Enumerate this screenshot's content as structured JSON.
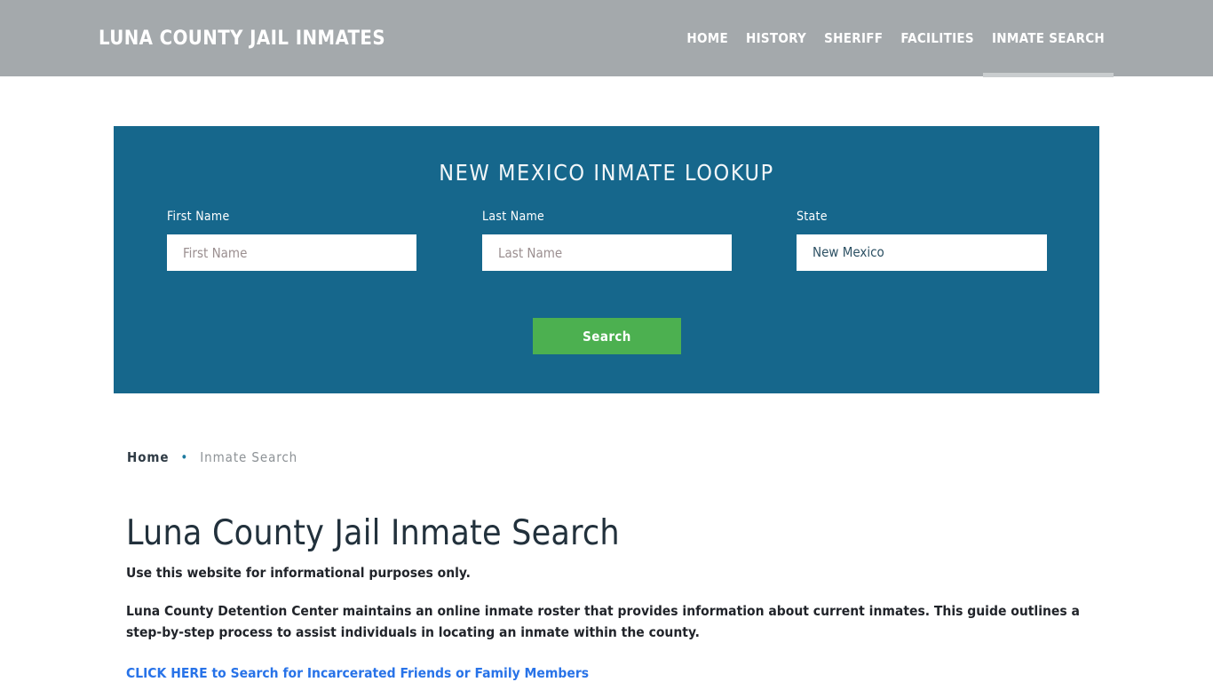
{
  "header": {
    "brand": "LUNA COUNTY JAIL INMATES",
    "background_color": "#a4a9ac",
    "nav": [
      {
        "label": "HOME",
        "active": false
      },
      {
        "label": "HISTORY",
        "active": false
      },
      {
        "label": "SHERIFF",
        "active": false
      },
      {
        "label": "FACILITIES",
        "active": false
      },
      {
        "label": "INMATE SEARCH",
        "active": true
      }
    ],
    "active_indicator_color": "#c9cdcf"
  },
  "lookup_panel": {
    "title": "NEW MEXICO INMATE LOOKUP",
    "background_color": "#16678c",
    "fields": {
      "first_name": {
        "label": "First Name",
        "placeholder": "First Name",
        "value": ""
      },
      "last_name": {
        "label": "Last Name",
        "placeholder": "Last Name",
        "value": ""
      },
      "state": {
        "label": "State",
        "value": "New Mexico",
        "options": [
          "New Mexico"
        ]
      }
    },
    "search_button": {
      "label": "Search",
      "color": "#4cb050"
    }
  },
  "breadcrumb": {
    "home": "Home",
    "separator": "•",
    "current": "Inmate Search",
    "separator_color": "#1e7ba0"
  },
  "content": {
    "page_title": "Luna County Jail Inmate Search",
    "lead_note": "Use this website for informational purposes only.",
    "paragraph": "Luna County Detention Center maintains an online inmate roster that provides information about current inmates. This guide outlines a step-by-step process to assist individuals in locating an inmate within the county.",
    "cta_link": "CLICK HERE to Search for Incarcerated Friends or Family Members",
    "cta_link_color": "#2873e8"
  }
}
